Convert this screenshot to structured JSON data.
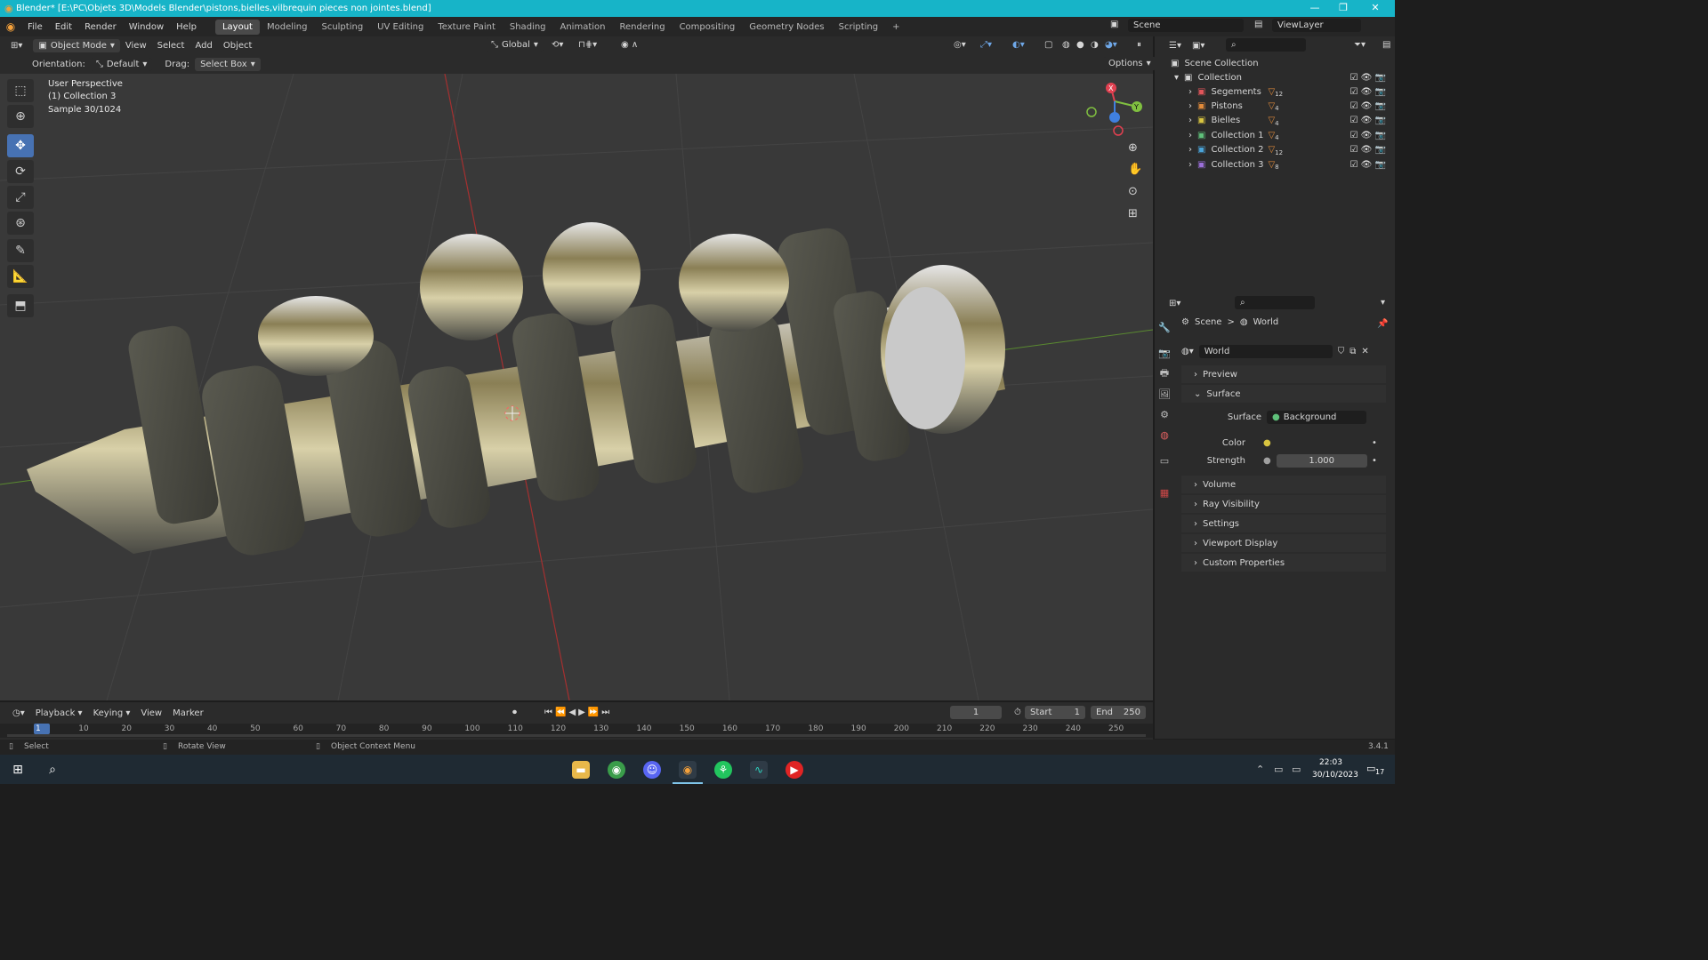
{
  "window": {
    "title": "Blender* [E:\\PC\\Objets 3D\\Models Blender\\pistons,bielles,vilbrequin pieces non jointes.blend]",
    "minimize": "—",
    "maximize": "❐",
    "close": "✕"
  },
  "menu": [
    "File",
    "Edit",
    "Render",
    "Window",
    "Help"
  ],
  "workspaces": [
    "Layout",
    "Modeling",
    "Sculpting",
    "UV Editing",
    "Texture Paint",
    "Shading",
    "Animation",
    "Rendering",
    "Compositing",
    "Geometry Nodes",
    "Scripting"
  ],
  "workspace_add": "+",
  "active_workspace": "Layout",
  "scene": {
    "label": "Scene",
    "viewlayer": "ViewLayer"
  },
  "header": {
    "mode": "Object Mode",
    "menus": [
      "View",
      "Select",
      "Add",
      "Object"
    ],
    "transform": "Global",
    "orientation_label": "Orientation:",
    "orientation_value": "Default",
    "drag_label": "Drag:",
    "drag_value": "Select Box",
    "options": "Options"
  },
  "viewport": {
    "info_line1": "User Perspective",
    "info_line2": "(1) Collection 3",
    "info_line3": "Sample 30/1024",
    "gizmo_x": "X",
    "gizmo_y": "Y"
  },
  "outliner": {
    "root": "Scene Collection",
    "collection": "Collection",
    "items": [
      {
        "name": "Segements",
        "count": "12",
        "color": "#e0555a"
      },
      {
        "name": "Pistons",
        "count": "4",
        "color": "#e08a3a"
      },
      {
        "name": "Bielles",
        "count": "4",
        "color": "#d8c440"
      },
      {
        "name": "Collection 1",
        "count": "4",
        "color": "#5fc07a"
      },
      {
        "name": "Collection 2",
        "count": "12",
        "color": "#4aa3d8"
      },
      {
        "name": "Collection 3",
        "count": "8",
        "color": "#9a6fd8"
      }
    ]
  },
  "properties": {
    "breadcrumb_scene": "Scene",
    "breadcrumb_sep": ">",
    "breadcrumb_world": "World",
    "world_name": "World",
    "panels_top": [
      "Preview",
      "Surface"
    ],
    "surface_label": "Surface",
    "surface_value": "Background",
    "color_label": "Color",
    "strength_label": "Strength",
    "strength_value": "1.000",
    "panels_bottom": [
      "Volume",
      "Ray Visibility",
      "Settings",
      "Viewport Display",
      "Custom Properties"
    ]
  },
  "timeline": {
    "menus": [
      "Playback",
      "Keying",
      "View",
      "Marker"
    ],
    "current_frame": "1",
    "start_label": "Start",
    "start_value": "1",
    "end_label": "End",
    "end_value": "250",
    "ticks": [
      "1",
      "10",
      "20",
      "30",
      "40",
      "50",
      "60",
      "70",
      "80",
      "90",
      "100",
      "110",
      "120",
      "130",
      "140",
      "150",
      "160",
      "170",
      "180",
      "190",
      "200",
      "210",
      "220",
      "230",
      "240",
      "250"
    ]
  },
  "statusbar": {
    "select": "Select",
    "rotate": "Rotate View",
    "context": "Object Context Menu",
    "version": "3.4.1"
  },
  "taskbar": {
    "time": "22:03",
    "date": "30/10/2023",
    "notif": "17"
  }
}
